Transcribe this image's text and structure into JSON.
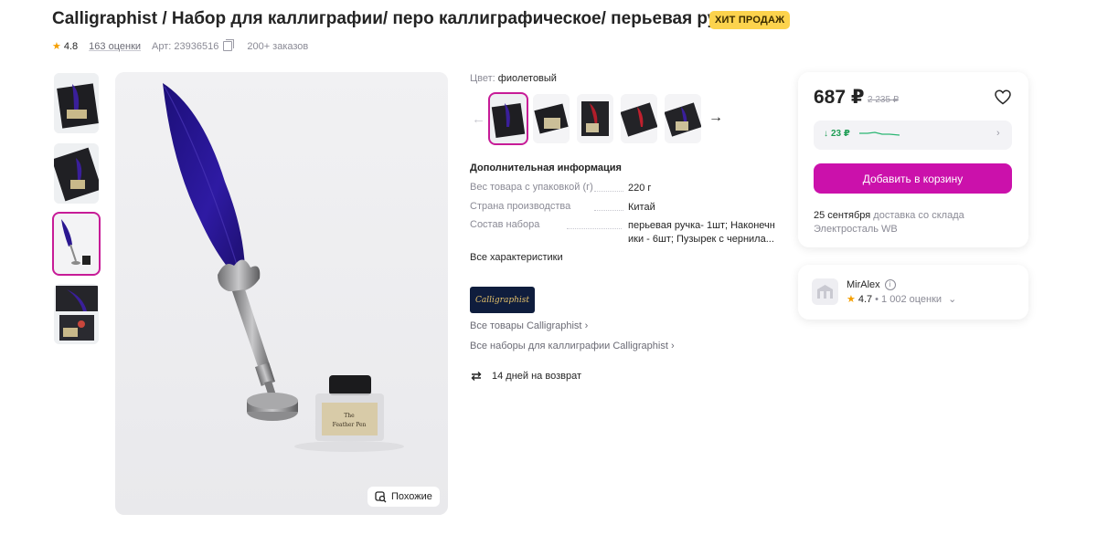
{
  "product": {
    "title": "Calligraphist / Набор для каллиграфии/ перо каллиграфическое/ перьевая ручка",
    "badge": "ХИТ ПРОДАЖ",
    "rating": "4.8",
    "reviews": "163 оценки",
    "article": "Арт: 23936516",
    "orders": "200+ заказов"
  },
  "gallery": {
    "similar_label": "Похожие",
    "thumbs": [
      "box-front",
      "box-open",
      "quill-ink",
      "box-ribbon"
    ],
    "selected_index": 2
  },
  "color": {
    "label": "Цвет:",
    "value": "фиолетовый",
    "options_count": 5
  },
  "specs": {
    "heading": "Дополнительная информация",
    "rows": [
      {
        "name": "Вес товара с упаковкой (г)",
        "value": "220 г"
      },
      {
        "name": "Страна производства",
        "value": "Китай"
      },
      {
        "name": "Состав набора",
        "value": "перьевая ручка- 1шт; Наконечн",
        "value2": "ики - 6шт; Пузырек с чернила..."
      }
    ],
    "all_label": "Все характеристики"
  },
  "brand": {
    "logo_text": "Calligraphist",
    "all_goods": "Все товары Calligraphist",
    "all_sets": "Все наборы для каллиграфии Calligraphist"
  },
  "returns": {
    "label": "14 дней на возврат"
  },
  "price": {
    "current": "687 ₽",
    "old": "2 235 ₽",
    "trend": "23 ₽",
    "cart_button": "Добавить в корзину",
    "delivery_date": "25 сентября",
    "delivery_text": "доставка со склада",
    "warehouse": "Электросталь WB"
  },
  "seller": {
    "name": "MirAlex",
    "rating": "4.7",
    "reviews": "1 002 оценки"
  },
  "colors": {
    "accent": "#cb11ab",
    "select_outline": "#c71b97",
    "badge": "#fcd34d",
    "trend": "#1f9d55"
  }
}
